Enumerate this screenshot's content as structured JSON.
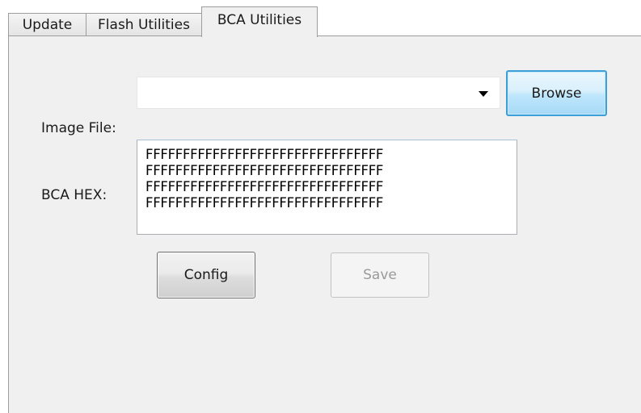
{
  "tabs": {
    "update": "Update",
    "flash_utilities": "Flash Utilities",
    "bca_utilities": "BCA Utilities",
    "active": "BCA Utilities"
  },
  "image_file": {
    "label": "Image File:",
    "value": "",
    "browse_label": "Browse"
  },
  "bca_hex": {
    "label": "BCA HEX:",
    "lines": [
      "FFFFFFFFFFFFFFFFFFFFFFFFFFFFFFFF",
      "FFFFFFFFFFFFFFFFFFFFFFFFFFFFFFFF",
      "FFFFFFFFFFFFFFFFFFFFFFFFFFFFFFFF",
      "FFFFFFFFFFFFFFFFFFFFFFFFFFFFFFFF"
    ]
  },
  "actions": {
    "config_label": "Config",
    "save_label": "Save",
    "save_enabled": false
  },
  "colors": {
    "panel_bg": "#f0f0f0",
    "browse_focus_border": "#3c9fd8",
    "disabled_text": "#9a9a9a"
  },
  "icons": {
    "combo_dropdown": "dropdown-arrow-icon"
  }
}
